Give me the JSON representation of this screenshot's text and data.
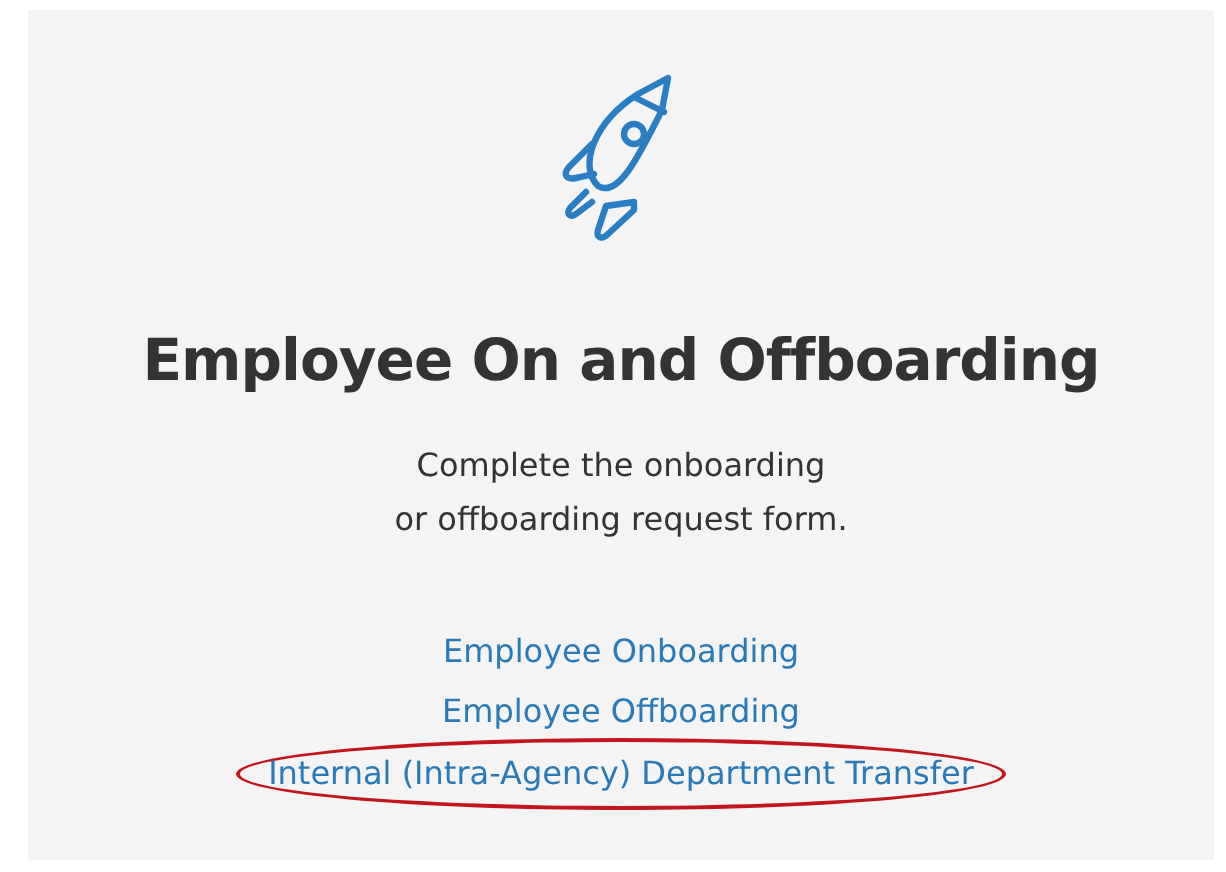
{
  "card": {
    "title": "Employee On and Offboarding",
    "description_lines": [
      "Complete the onboarding",
      "or offboarding request form."
    ],
    "links": [
      {
        "label": "Employee Onboarding",
        "highlighted": false
      },
      {
        "label": "Employee Offboarding",
        "highlighted": false
      },
      {
        "label": "Internal (Intra-Agency) Department Transfer",
        "highlighted": true
      }
    ]
  }
}
